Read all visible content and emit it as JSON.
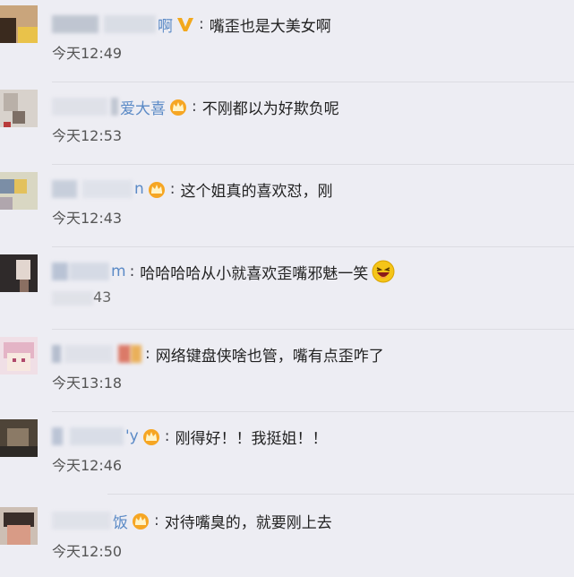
{
  "comments": [
    {
      "name": "啊",
      "badge": "verified-v",
      "text": "嘴歪也是大美女啊",
      "time": "今天12:49"
    },
    {
      "name": "爱大喜",
      "badge": "crown",
      "text": "不刚都以为好欺负呢",
      "time": "今天12:53"
    },
    {
      "name": "n",
      "badge": "crown",
      "text": "这个姐真的喜欢怼，刚",
      "time": "今天12:43"
    },
    {
      "name": "m",
      "badge": "",
      "text": "哈哈哈哈从小就喜欢歪嘴邪魅一笑",
      "time": "43",
      "emoji": "laughing-emoji"
    },
    {
      "name": "",
      "badge": "",
      "text": "网络键盘侠啥也管，嘴有点歪咋了",
      "time": "今天13:18"
    },
    {
      "name": "'y",
      "badge": "crown",
      "text": "刚得好！！我挺姐！！",
      "time": "今天12:46"
    },
    {
      "name": "饭",
      "badge": "crown",
      "text": "对待嘴臭的，就要刚上去",
      "time": "今天12:50"
    }
  ],
  "colon": ":"
}
